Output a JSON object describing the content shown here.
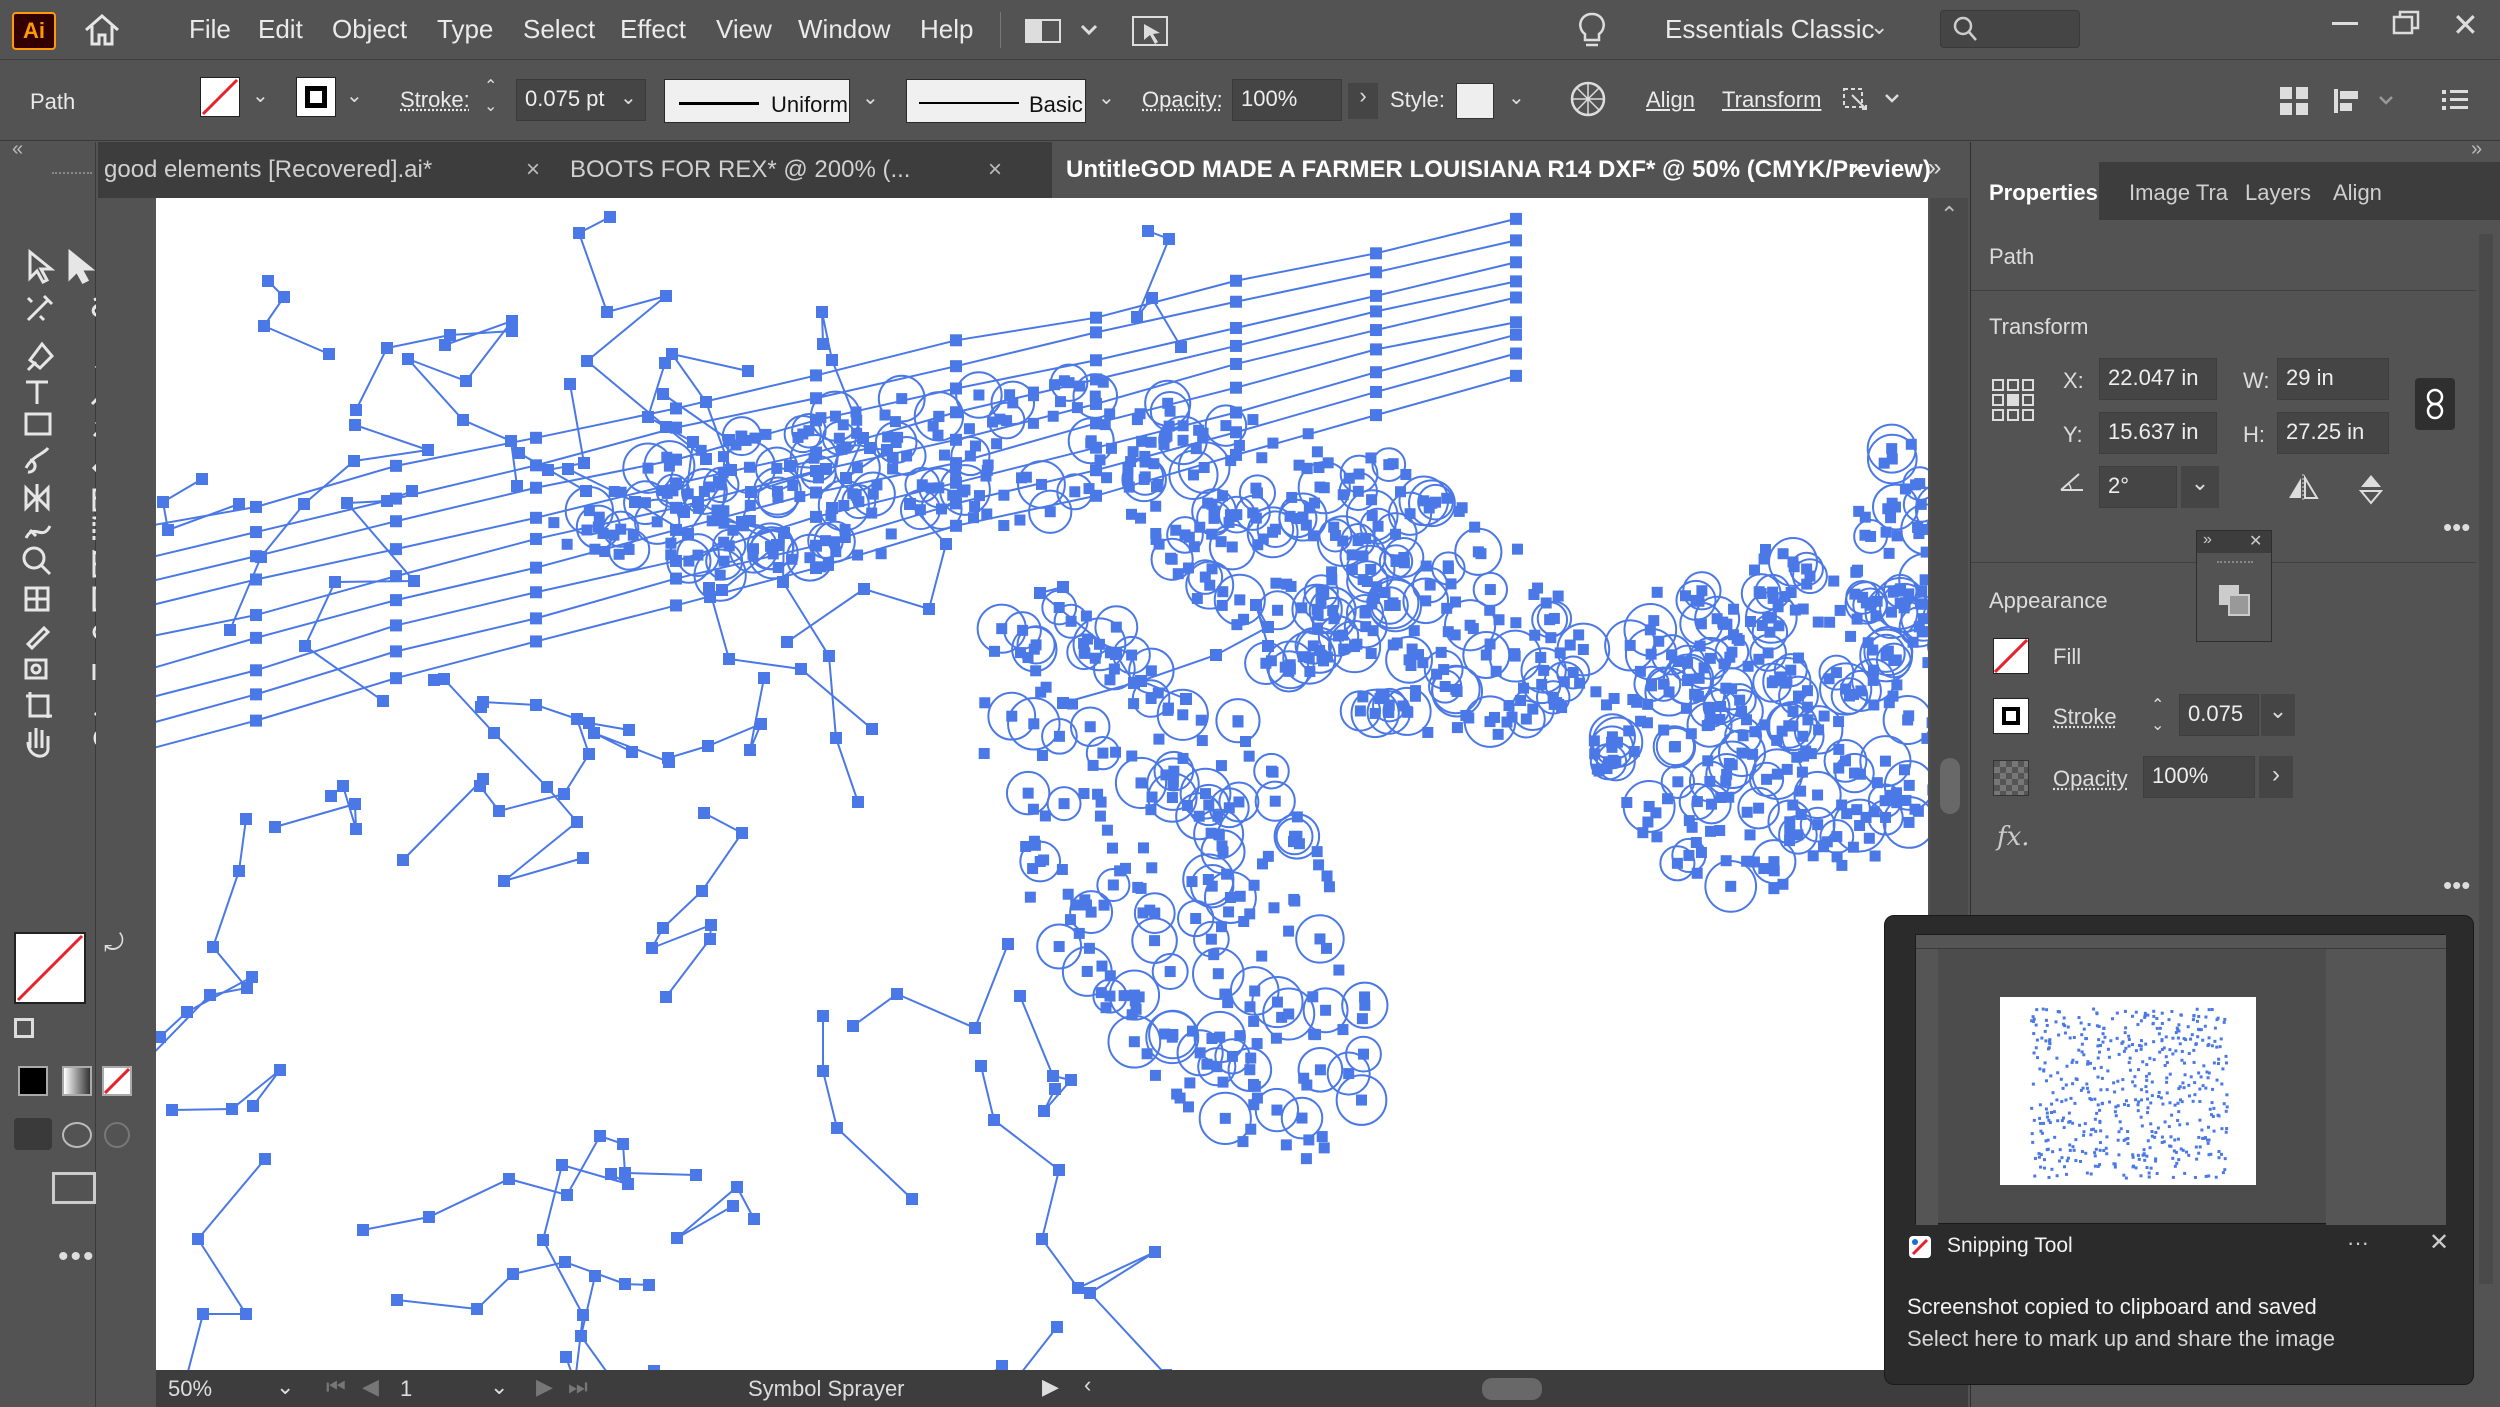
{
  "app": {
    "logo_text": "Ai",
    "menu": [
      "File",
      "Edit",
      "Object",
      "Type",
      "Select",
      "Effect",
      "View",
      "Window",
      "Help"
    ],
    "workspace": "Essentials Classic"
  },
  "control_bar": {
    "selection_type": "Path",
    "stroke_label": "Stroke:",
    "stroke_value": "0.075 pt",
    "profile": "Uniform",
    "brush": "Basic",
    "opacity_label": "Opacity:",
    "opacity_value": "100%",
    "style_label": "Style:",
    "align_label": "Align",
    "transform_label": "Transform"
  },
  "tabs": [
    {
      "label": "good elements [Recovered].ai*",
      "active": false
    },
    {
      "label": "BOOTS FOR REX* @ 200% (...",
      "active": false
    },
    {
      "label": "UntitleGOD MADE A FARMER LOUISIANA R14 DXF* @ 50% (CMYK/Preview)",
      "active": true
    }
  ],
  "status_bar": {
    "zoom": "50%",
    "artboard": "1",
    "tool": "Symbol Sprayer"
  },
  "properties": {
    "tabs": [
      "Properties",
      "Image Tra",
      "Layers",
      "Align"
    ],
    "active_tab": "Properties",
    "object_type": "Path",
    "transform_title": "Transform",
    "x_label": "X:",
    "x_value": "22.047 in",
    "y_label": "Y:",
    "y_value": "15.637 in",
    "w_label": "W:",
    "w_value": "29 in",
    "h_label": "H:",
    "h_value": "27.25 in",
    "angle_value": "2°",
    "appearance_title": "Appearance",
    "fill_label": "Fill",
    "stroke_label": "Stroke",
    "stroke_value": "0.075",
    "opacity_label": "Opacity",
    "opacity_value": "100%",
    "fx_label": "fx."
  },
  "notification": {
    "app_name": "Snipping Tool",
    "line1": "Screenshot copied to clipboard and saved",
    "line2": "Select here to mark up and share the image"
  },
  "colors": {
    "path_blue": "#4a78e6",
    "accent_red": "#e8202a",
    "ui_bg": "#535353"
  }
}
